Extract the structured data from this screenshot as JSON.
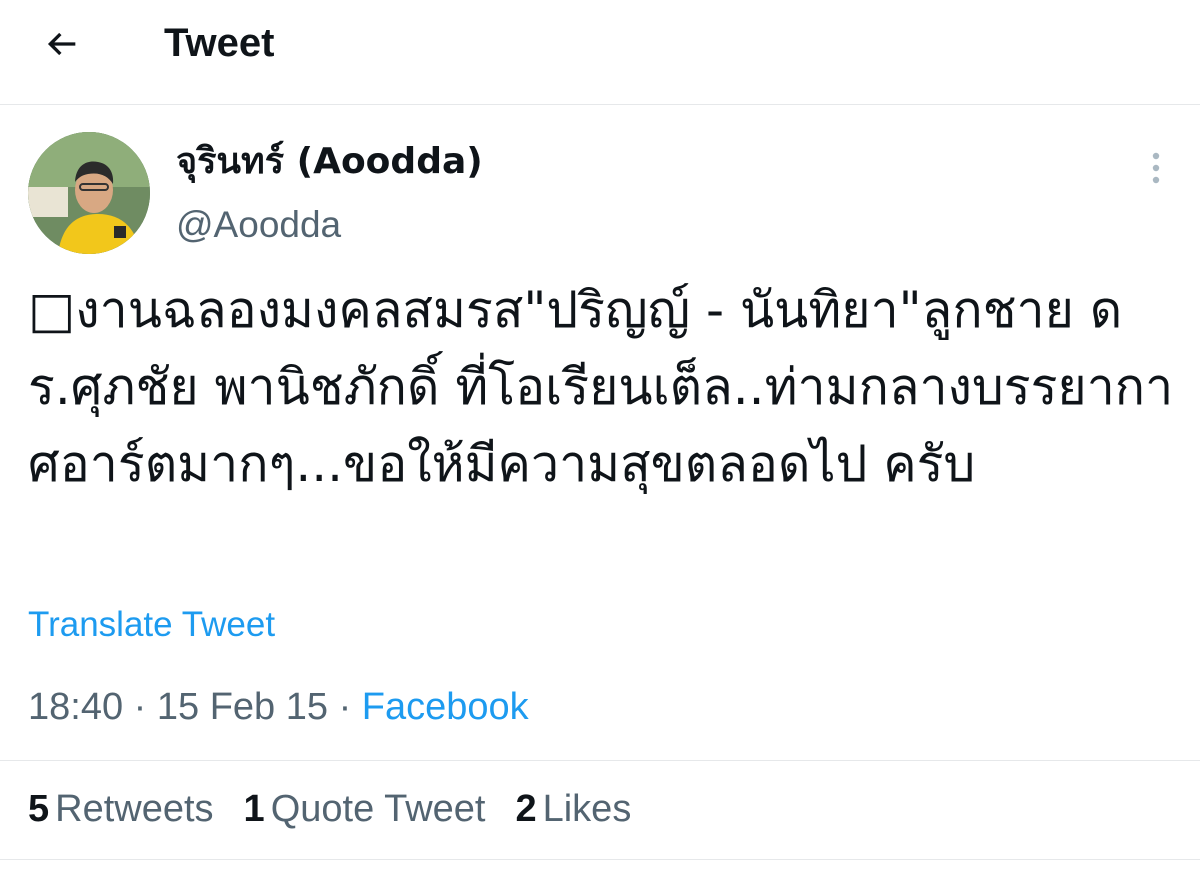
{
  "header": {
    "title": "Tweet"
  },
  "author": {
    "name": "จุรินทร์ (Aoodda)",
    "handle": "@Aoodda"
  },
  "tweet": {
    "text": "□งานฉลองมงคลสมรส\"ปริญญ์ - นันทิยา\"ลูกชาย ดร.ศุภชัย พานิชภักดิ์ ที่โอเรียนเต็ล..ท่ามกลางบรรยากาศอาร์ตมากๆ...ขอให้มีความสุขตลอดไป ครับ",
    "translate_label": "Translate Tweet",
    "time": "18:40",
    "date": "15 Feb 15",
    "separator": "·",
    "source": "Facebook"
  },
  "stats": {
    "retweets_count": "5",
    "retweets_label": "Retweets",
    "quotes_count": "1",
    "quotes_label": "Quote Tweet",
    "likes_count": "2",
    "likes_label": "Likes"
  },
  "colors": {
    "accent": "#1d9bf0",
    "secondary_text": "#536471",
    "divider": "#e6e8ea"
  }
}
